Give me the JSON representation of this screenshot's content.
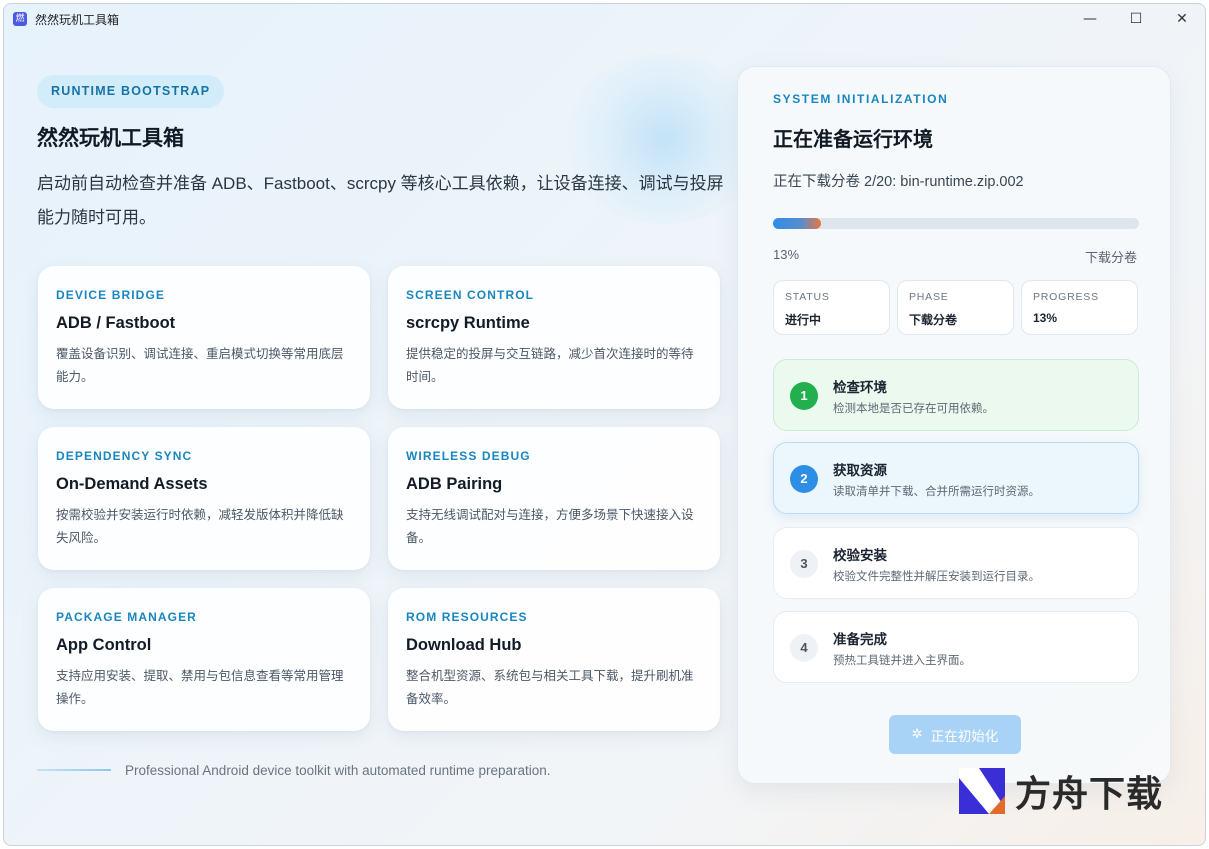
{
  "window": {
    "title": "然然玩机工具箱",
    "icon_glyph": "燃",
    "minimize_glyph": "—",
    "maximize_glyph": "☐",
    "close_glyph": "✕"
  },
  "hero": {
    "badge": "RUNTIME BOOTSTRAP",
    "title": "然然玩机工具箱",
    "description": "启动前自动检查并准备 ADB、Fastboot、scrcpy 等核心工具依赖，让设备连接、调试与投屏能力随时可用。"
  },
  "features": [
    {
      "category": "DEVICE BRIDGE",
      "title": "ADB / Fastboot",
      "description": "覆盖设备识别、调试连接、重启模式切换等常用底层能力。"
    },
    {
      "category": "SCREEN CONTROL",
      "title": "scrcpy Runtime",
      "description": "提供稳定的投屏与交互链路，减少首次连接时的等待时间。"
    },
    {
      "category": "DEPENDENCY SYNC",
      "title": "On-Demand Assets",
      "description": "按需校验并安装运行时依赖，减轻发版体积并降低缺失风险。"
    },
    {
      "category": "WIRELESS DEBUG",
      "title": "ADB Pairing",
      "description": "支持无线调试配对与连接，方便多场景下快速接入设备。"
    },
    {
      "category": "PACKAGE MANAGER",
      "title": "App Control",
      "description": "支持应用安装、提取、禁用与包信息查看等常用管理操作。"
    },
    {
      "category": "ROM RESOURCES",
      "title": "Download Hub",
      "description": "整合机型资源、系统包与相关工具下载，提升刷机准备效率。"
    }
  ],
  "footer": {
    "text": "Professional Android device toolkit with automated runtime preparation."
  },
  "panel": {
    "label": "SYSTEM INITIALIZATION",
    "title": "正在准备运行环境",
    "status_line": "正在下载分卷 2/20: bin-runtime.zip.002",
    "progress_fraction": 0.13,
    "progress_text": "13%",
    "progress_caption": "下载分卷",
    "stats": [
      {
        "key": "STATUS",
        "value": "进行中"
      },
      {
        "key": "PHASE",
        "value": "下载分卷"
      },
      {
        "key": "PROGRESS",
        "value": "13%"
      }
    ],
    "steps": [
      {
        "num": "1",
        "title": "检查环境",
        "description": "检测本地是否已存在可用依赖。",
        "state": "done"
      },
      {
        "num": "2",
        "title": "获取资源",
        "description": "读取清单并下载、合并所需运行时资源。",
        "state": "active"
      },
      {
        "num": "3",
        "title": "校验安装",
        "description": "校验文件完整性并解压安装到运行目录。",
        "state": "pending"
      },
      {
        "num": "4",
        "title": "准备完成",
        "description": "预热工具链并进入主界面。",
        "state": "pending"
      }
    ],
    "button_label": "正在初始化",
    "button_icon": "spinner-icon"
  },
  "watermark": {
    "text": "方舟下载"
  },
  "colors": {
    "accent": "#1a86bf",
    "progress_start": "#2d8ee6",
    "progress_end": "#e8763c",
    "done_green": "#22b04e",
    "active_blue": "#2d8ee6",
    "button_bg": "#a9d3f6"
  }
}
